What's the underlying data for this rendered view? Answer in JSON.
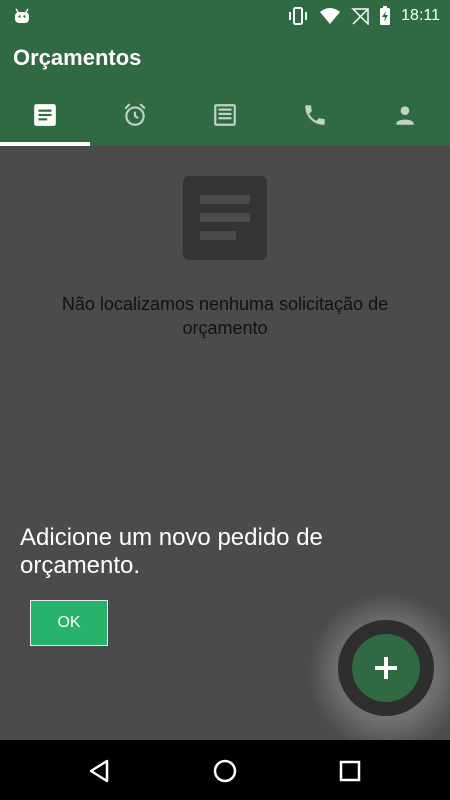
{
  "status_bar": {
    "time": "18:11",
    "icons": [
      "android-icon",
      "vibrate-icon",
      "wifi-icon",
      "no-sim-icon",
      "battery-charging-icon"
    ]
  },
  "app": {
    "title": "Orçamentos",
    "primary_color": "#2f6a43",
    "accent_color": "#27b36b"
  },
  "tabs": [
    {
      "icon": "list-document-icon",
      "selected": true
    },
    {
      "icon": "alarm-icon",
      "selected": false
    },
    {
      "icon": "news-icon",
      "selected": false
    },
    {
      "icon": "phone-icon",
      "selected": false
    },
    {
      "icon": "person-icon",
      "selected": false
    }
  ],
  "empty_state": {
    "icon": "document-lines-icon",
    "message": "Não localizamos nenhuma solicitação de orçamento"
  },
  "coach_mark": {
    "text": "Adicione um novo pedido de orçamento.",
    "ok_label": "OK"
  },
  "fab": {
    "icon": "plus-icon"
  },
  "nav_bar": {
    "icons": [
      "back-icon",
      "home-icon",
      "recents-icon"
    ]
  }
}
